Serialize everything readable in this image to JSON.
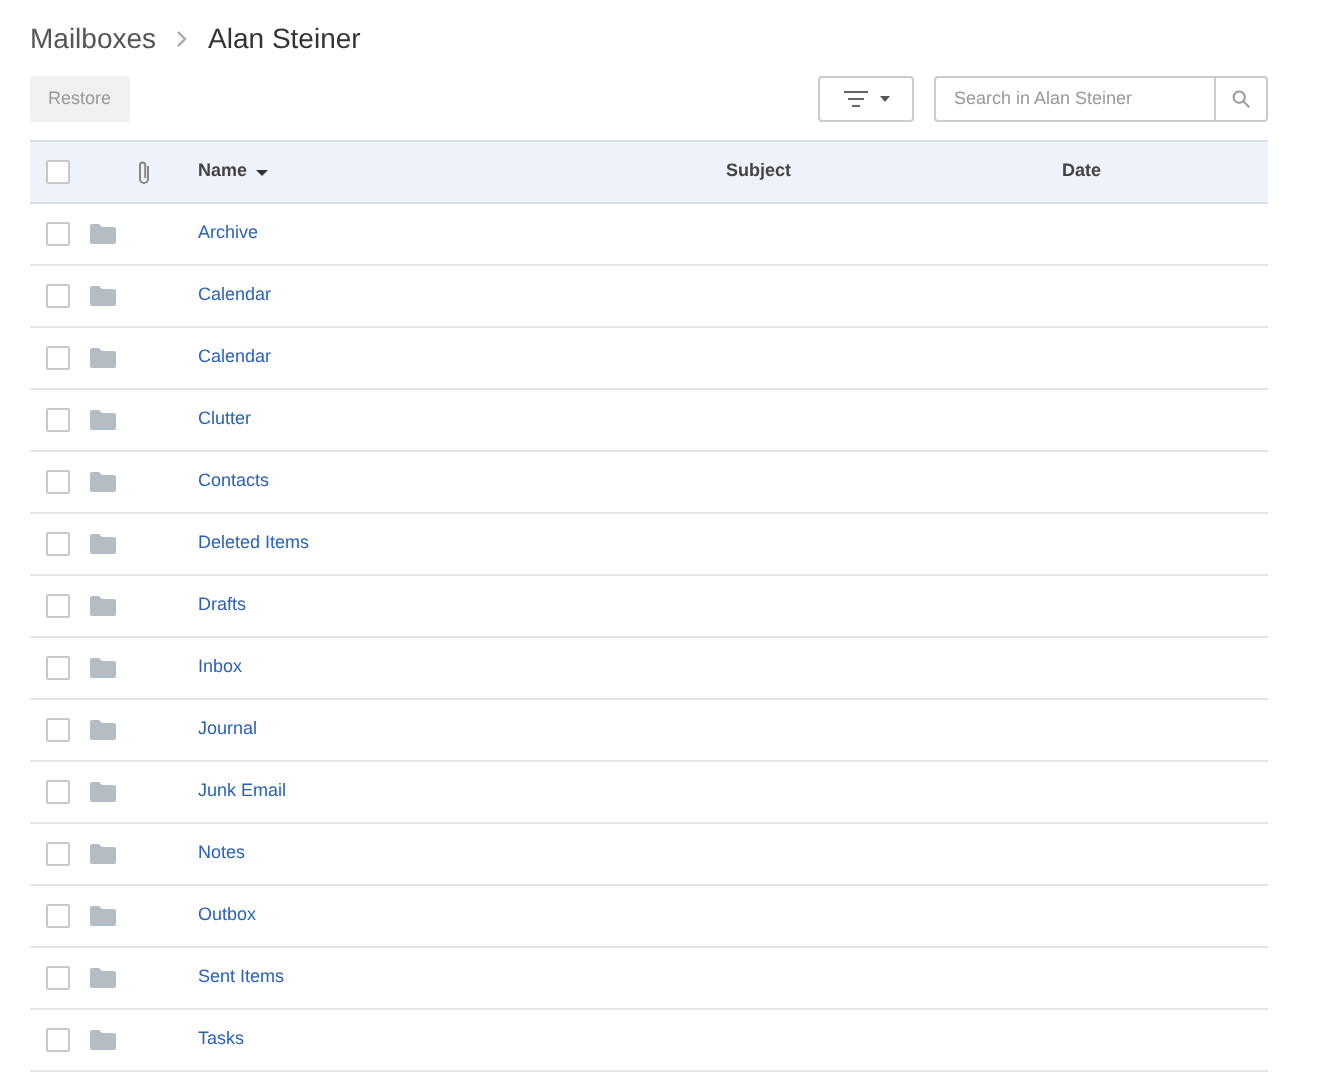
{
  "breadcrumb": [
    "Mailboxes",
    "Alan Steiner"
  ],
  "toolbar": {
    "restore_button": {
      "label": "Restore",
      "disabled": true
    },
    "search": {
      "placeholder": "Search in Alan Steiner"
    }
  },
  "table": {
    "select_all": {
      "checked": false
    },
    "columns": [
      {
        "label": "Name",
        "sorted": true
      },
      {
        "label": "Subject",
        "sorted": false
      },
      {
        "label": "Date",
        "sorted": false
      }
    ],
    "rows": [
      {
        "name": "Archive",
        "checked": false
      },
      {
        "name": "Calendar",
        "checked": false
      },
      {
        "name": "Calendar",
        "checked": false
      },
      {
        "name": "Clutter",
        "checked": false
      },
      {
        "name": "Contacts",
        "checked": false
      },
      {
        "name": "Deleted Items",
        "checked": false
      },
      {
        "name": "Drafts",
        "checked": false
      },
      {
        "name": "Inbox",
        "checked": false
      },
      {
        "name": "Journal",
        "checked": false
      },
      {
        "name": "Junk Email",
        "checked": false
      },
      {
        "name": "Notes",
        "checked": false
      },
      {
        "name": "Outbox",
        "checked": false
      },
      {
        "name": "Sent Items",
        "checked": false
      },
      {
        "name": "Tasks",
        "checked": false
      }
    ]
  }
}
